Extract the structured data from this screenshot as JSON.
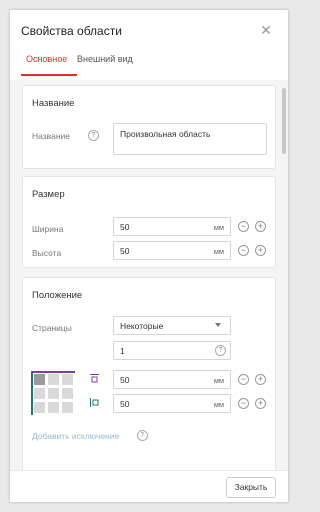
{
  "dialog": {
    "title": "Свойства области",
    "close_icon": "close-icon"
  },
  "tabs": [
    {
      "label": "Основное",
      "active": true
    },
    {
      "label": "Внешний вид",
      "active": false
    }
  ],
  "name_panel": {
    "title": "Название",
    "field_label": "Название",
    "value": "Произвольная область"
  },
  "size_panel": {
    "title": "Размер",
    "width_label": "Ширина",
    "width_value": "50",
    "width_unit": "мм",
    "height_label": "Высота",
    "height_value": "50",
    "height_unit": "мм"
  },
  "position_panel": {
    "title": "Положение",
    "pages_label": "Страницы",
    "pages_select": "Некоторые",
    "pages_value": "1",
    "top_value": "50",
    "top_unit": "мм",
    "left_value": "50",
    "left_unit": "мм",
    "add_exception": "Добавить исключение"
  },
  "footer": {
    "close_button": "Закрыть"
  },
  "colors": {
    "accent_red": "#e0302a",
    "grid_top": "#7b3fa0",
    "grid_left": "#1f7a6c",
    "link": "#9bb7d0"
  }
}
